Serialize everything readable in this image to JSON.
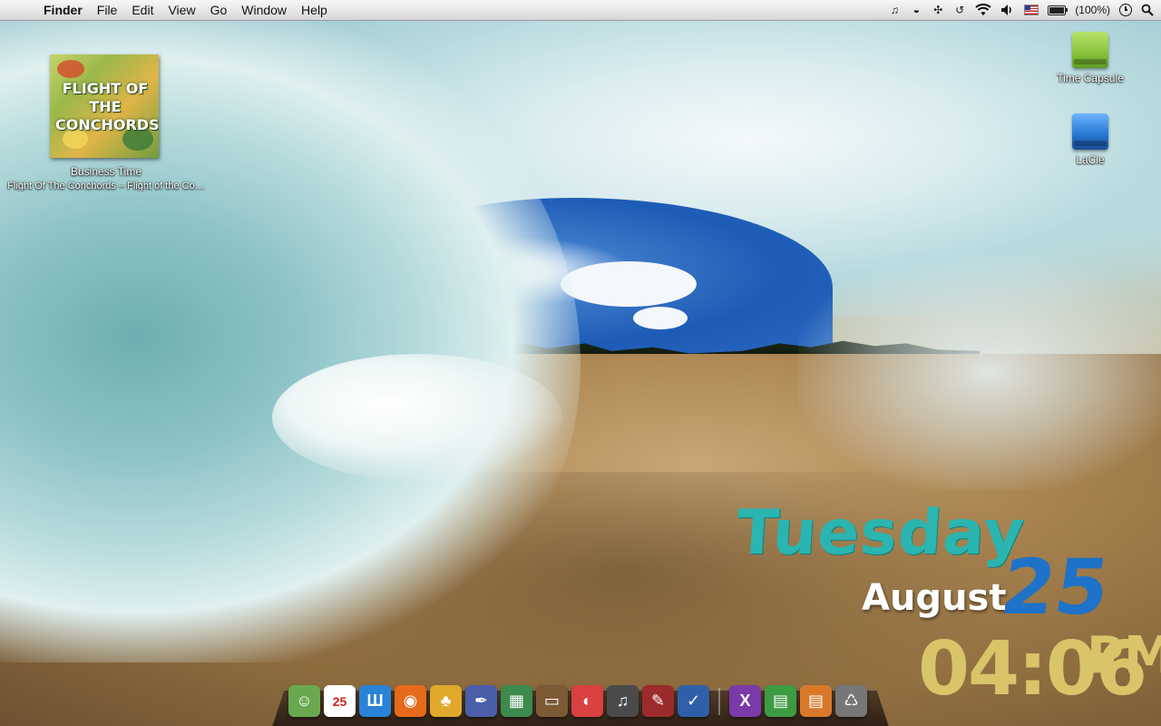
{
  "menubar": {
    "apple_icon": "apple-icon",
    "app_name": "Finder",
    "menus": [
      "File",
      "Edit",
      "View",
      "Go",
      "Window",
      "Help"
    ],
    "status": {
      "battery_text": "(100%)"
    }
  },
  "desktop": {
    "album": {
      "cover_title": "FLIGHT OF THE CONCHORDS",
      "track": "Business Time",
      "subtitle": "Flight Of The Conchords – Flight of the Co…"
    },
    "drives": [
      {
        "label": "Time Capsule",
        "color": "#8cc63f"
      },
      {
        "label": "LaCie",
        "color": "#2a7ad6"
      }
    ]
  },
  "widget": {
    "day": "Tuesday",
    "month": "August",
    "date": "25",
    "time": "04:06",
    "ampm": "PM"
  },
  "dock": {
    "apps": [
      {
        "name": "finder-icon",
        "glyph": "☺",
        "color": "#6aa84f"
      },
      {
        "name": "ical-icon",
        "glyph": "25",
        "color": "#ffffff"
      },
      {
        "name": "wordpress-icon",
        "glyph": "Ш",
        "color": "#2b83d6"
      },
      {
        "name": "firefox-icon",
        "glyph": "◉",
        "color": "#e56a1b"
      },
      {
        "name": "adium-icon",
        "glyph": "♣",
        "color": "#e0a92c"
      },
      {
        "name": "pen-tool-icon",
        "glyph": "✒",
        "color": "#4a5fa8"
      },
      {
        "name": "charts-icon",
        "glyph": "▦",
        "color": "#3c8a4c"
      },
      {
        "name": "keynote-icon",
        "glyph": "▭",
        "color": "#7b5a34"
      },
      {
        "name": "photo-icon",
        "glyph": "◐",
        "color": "#d94040"
      },
      {
        "name": "itunes-icon",
        "glyph": "♫",
        "color": "#4a4a4a"
      },
      {
        "name": "script-icon",
        "glyph": "✎",
        "color": "#9c2b2b"
      },
      {
        "name": "omnifocus-icon",
        "glyph": "✓",
        "color": "#2f5fa8"
      },
      {
        "name": "xcode-icon",
        "glyph": "X",
        "color": "#7a3aa8"
      },
      {
        "name": "folder-green-icon",
        "glyph": "▤",
        "color": "#3e9b43"
      },
      {
        "name": "folder-orange-icon",
        "glyph": "▤",
        "color": "#d8792a"
      },
      {
        "name": "trash-icon",
        "glyph": "♺",
        "color": "#777777"
      }
    ]
  }
}
